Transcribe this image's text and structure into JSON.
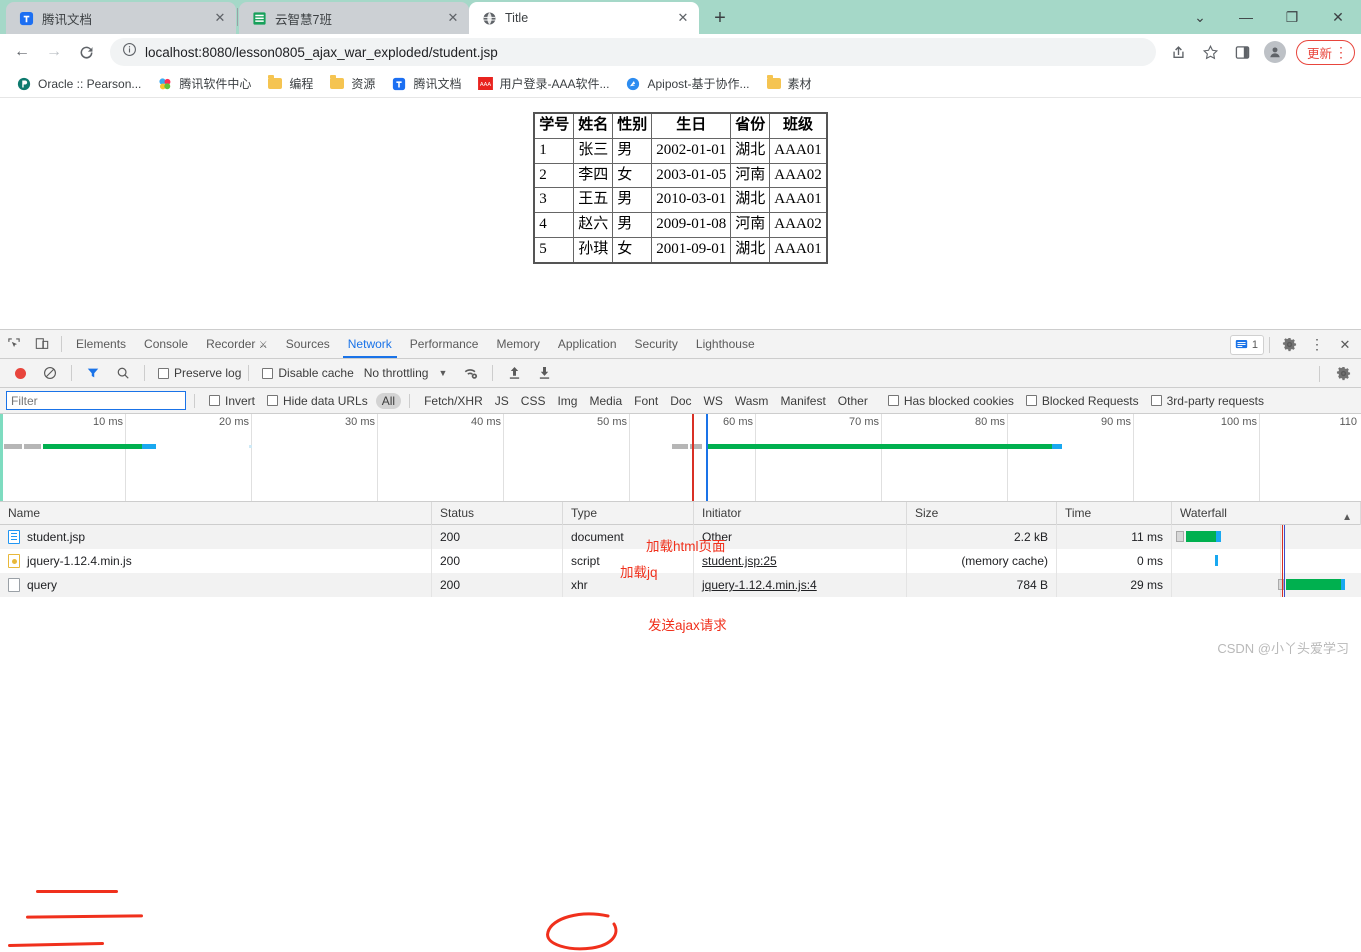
{
  "browser": {
    "tabs": [
      {
        "title": "腾讯文档",
        "icon": "tencent-docs-icon",
        "active": false
      },
      {
        "title": "云智慧7班",
        "icon": "spreadsheet-icon",
        "active": false
      },
      {
        "title": "Title",
        "icon": "globe-icon",
        "active": true
      }
    ],
    "new_tab_label": "+",
    "window_controls": {
      "expand": "⌄",
      "minimize": "—",
      "maximize": "❐",
      "close": "✕"
    },
    "nav": {
      "back": "←",
      "forward": "→",
      "reload": "⟳",
      "site_info_icon": "info-circle-icon",
      "url": "localhost:8080/lesson0805_ajax_war_exploded/student.jsp",
      "share_icon": "share-icon",
      "bookmark_icon": "star-icon",
      "sidepanel_icon": "side-panel-icon",
      "profile_icon": "profile-avatar-icon",
      "update_label": "更新",
      "menu_icon": "kebab-menu-icon"
    },
    "bookmarks": [
      {
        "label": "Oracle :: Pearson...",
        "icon": "pearson-icon"
      },
      {
        "label": "腾讯软件中心",
        "icon": "tencent-software-icon"
      },
      {
        "label": "编程",
        "icon": "folder-icon"
      },
      {
        "label": "资源",
        "icon": "folder-icon"
      },
      {
        "label": "腾讯文档",
        "icon": "tencent-docs-icon"
      },
      {
        "label": "用户登录-AAA软件...",
        "icon": "aaa-icon"
      },
      {
        "label": "Apipost-基于协作...",
        "icon": "apipost-icon"
      },
      {
        "label": "素材",
        "icon": "folder-icon"
      }
    ]
  },
  "page": {
    "table": {
      "headers": [
        "学号",
        "姓名",
        "性别",
        "生日",
        "省份",
        "班级"
      ],
      "rows": [
        [
          "1",
          "张三",
          "男",
          "2002-01-01",
          "湖北",
          "AAA01"
        ],
        [
          "2",
          "李四",
          "女",
          "2003-01-05",
          "河南",
          "AAA02"
        ],
        [
          "3",
          "王五",
          "男",
          "2010-03-01",
          "湖北",
          "AAA01"
        ],
        [
          "4",
          "赵六",
          "男",
          "2009-01-08",
          "河南",
          "AAA02"
        ],
        [
          "5",
          "孙琪",
          "女",
          "2001-09-01",
          "湖北",
          "AAA01"
        ]
      ]
    }
  },
  "devtools": {
    "inspect_icon": "inspect-element-icon",
    "device_icon": "device-toolbar-icon",
    "tabs": [
      {
        "label": "Elements",
        "selected": false
      },
      {
        "label": "Console",
        "selected": false
      },
      {
        "label": "Recorder",
        "selected": false,
        "badge_icon": "flask-icon"
      },
      {
        "label": "Sources",
        "selected": false
      },
      {
        "label": "Network",
        "selected": true
      },
      {
        "label": "Performance",
        "selected": false
      },
      {
        "label": "Memory",
        "selected": false
      },
      {
        "label": "Application",
        "selected": false
      },
      {
        "label": "Security",
        "selected": false
      },
      {
        "label": "Lighthouse",
        "selected": false
      }
    ],
    "message_count": "1",
    "settings_icon": "gear-icon",
    "more_icon": "kebab-menu-icon",
    "close_icon": "close-icon",
    "toolbar": {
      "record_icon": "record-stop-icon",
      "clear_icon": "clear-icon",
      "filter_icon": "filter-funnel-icon",
      "search_icon": "search-icon",
      "preserve_log": "Preserve log",
      "disable_cache": "Disable cache",
      "throttling": "No throttling",
      "throttle_caret": "▼",
      "network_conditions_icon": "wifi-settings-icon",
      "import_icon": "upload-har-icon",
      "export_icon": "download-har-icon",
      "settings_icon": "gear-icon"
    },
    "filterbar": {
      "filter_placeholder": "Filter",
      "filter_value": "",
      "invert": "Invert",
      "hide_data_urls": "Hide data URLs",
      "types": [
        "All",
        "Fetch/XHR",
        "JS",
        "CSS",
        "Img",
        "Media",
        "Font",
        "Doc",
        "WS",
        "Wasm",
        "Manifest",
        "Other"
      ],
      "selected_type": "All",
      "has_blocked_cookies": "Has blocked cookies",
      "blocked_requests": "Blocked Requests",
      "third_party_requests": "3rd-party requests"
    },
    "overview": {
      "ticks": [
        "10 ms",
        "20 ms",
        "30 ms",
        "40 ms",
        "50 ms",
        "60 ms",
        "70 ms",
        "80 ms",
        "90 ms",
        "100 ms",
        "110"
      ]
    },
    "requests": {
      "columns": [
        "Name",
        "Status",
        "Type",
        "Initiator",
        "Size",
        "Time",
        "Waterfall"
      ],
      "sort_indicator": "▲",
      "rows": [
        {
          "name": "student.jsp",
          "icon": "document-file-icon",
          "status": "200",
          "type": "document",
          "initiator": "Other",
          "initiator_link": false,
          "size": "2.2 kB",
          "time": "11 ms"
        },
        {
          "name": "jquery-1.12.4.min.js",
          "icon": "script-file-icon",
          "status": "200",
          "type": "script",
          "initiator": "student.jsp:25",
          "initiator_link": true,
          "size": "(memory cache)",
          "time": "0 ms"
        },
        {
          "name": "query",
          "icon": "xhr-file-icon",
          "status": "200",
          "type": "xhr",
          "initiator": "jquery-1.12.4.min.js:4",
          "initiator_link": true,
          "size": "784 B",
          "time": "29 ms"
        }
      ]
    },
    "annotations": [
      {
        "text": "加载html页面",
        "target": "student-jsp-row"
      },
      {
        "text": "加载jq",
        "target": "jquery-row"
      },
      {
        "text": "发送ajax请求",
        "target": "query-xhr-row"
      }
    ]
  },
  "watermark": "CSDN @小丫头爱学习",
  "colors": {
    "tabstrip": "#a5d8c8",
    "accent_blue": "#1a73e8",
    "annotation_red": "#f0301c",
    "waterfall_green": "#00b04f",
    "waterfall_blue": "#19a8f0"
  }
}
